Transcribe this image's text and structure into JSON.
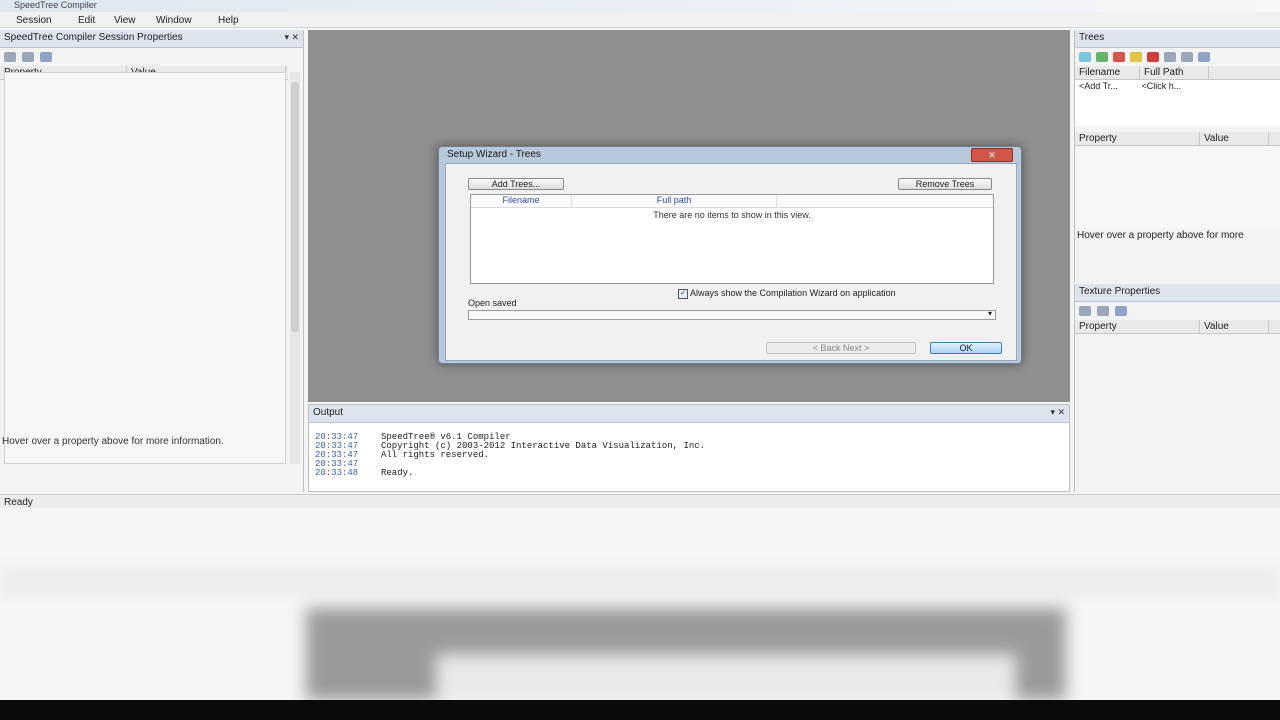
{
  "window": {
    "title": "SpeedTree Compiler"
  },
  "menu": [
    "Session",
    "Edit",
    "View",
    "Window",
    "Help"
  ],
  "left_panel": {
    "title": "SpeedTree Compiler Session Properties",
    "columns": [
      "Property",
      "Value"
    ],
    "hint": "Hover over a property above for more information."
  },
  "dialog": {
    "title": "Setup Wizard - Trees",
    "add_button": "Add Trees...",
    "remove_button": "Remove Trees",
    "columns": [
      "Filename",
      "Full path"
    ],
    "empty_text": "There are no items to show in this view.",
    "checkbox_label": "Always show the Compilation Wizard on application",
    "open_label": "Open saved",
    "nav_label": "< Back   Next >",
    "ok_label": "OK"
  },
  "output": {
    "title": "Output",
    "lines": [
      {
        "time": "20:33:47",
        "text": "SpeedTree® v6.1 Compiler"
      },
      {
        "time": "20:33:47",
        "text": "Copyright (c) 2003-2012 Interactive Data Visualization, Inc."
      },
      {
        "time": "20:33:47",
        "text": "All rights reserved."
      },
      {
        "time": "20:33:47",
        "text": ""
      },
      {
        "time": "20:33:48",
        "text": "Ready."
      }
    ]
  },
  "trees_panel": {
    "title": "Trees",
    "columns": [
      "Filename",
      "Full Path"
    ],
    "row": [
      "<Add Tr...",
      "<Click h..."
    ],
    "prop_columns": [
      "Property",
      "Value"
    ],
    "hint": "Hover over a property above for more"
  },
  "texture_panel": {
    "title": "Texture Properties",
    "columns": [
      "Property",
      "Value"
    ]
  },
  "status": {
    "text": "Ready"
  },
  "icons": [
    "pin-icon",
    "close-icon",
    "checkbox-icon",
    "dropdown-arrow-icon"
  ],
  "colors": {
    "viewport": "#8f8f8f",
    "dialog_frame": "#b9c9dc",
    "ok_button": "#c8e4f8",
    "timestamp": "#3a5fb0"
  }
}
